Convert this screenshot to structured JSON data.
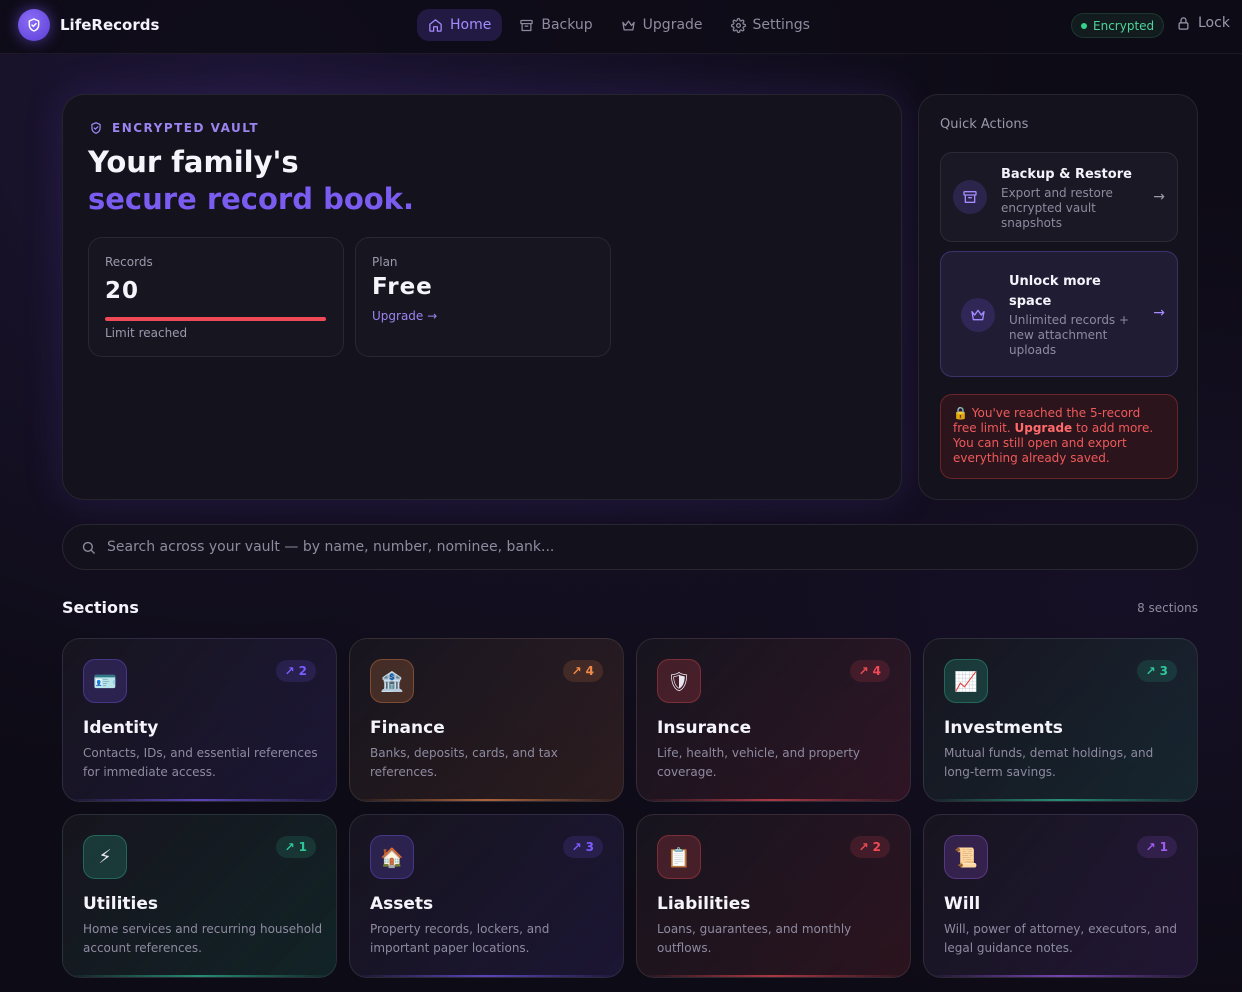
{
  "app": {
    "name": "LifeRecords"
  },
  "nav": [
    {
      "label": "Home",
      "icon": "home-icon",
      "active": true
    },
    {
      "label": "Backup",
      "icon": "archive-icon",
      "active": false
    },
    {
      "label": "Upgrade",
      "icon": "crown-icon",
      "active": false
    },
    {
      "label": "Settings",
      "icon": "gear-icon",
      "active": false
    }
  ],
  "status": {
    "encrypted_label": "Encrypted",
    "lock_label": "Lock"
  },
  "hero": {
    "eyebrow": "ENCRYPTED VAULT",
    "title_line1": "Your family's",
    "title_line2": "secure record book.",
    "records": {
      "label": "Records",
      "value": "20",
      "sub": "Limit reached",
      "usage_fraction": 1.0
    },
    "plan": {
      "label": "Plan",
      "value": "Free",
      "link": "Upgrade →"
    }
  },
  "quick_actions": {
    "title": "Quick Actions",
    "backup": {
      "name": "Backup & Restore",
      "desc": "Export and restore encrypted vault snapshots",
      "arrow": "→"
    },
    "upgrade": {
      "name": "Unlock more space",
      "desc": "Unlimited records + new attachment uploads",
      "arrow": "→"
    },
    "warning": {
      "prefix": "🔒 You've reached the 5-record free limit. ",
      "strong": "Upgrade",
      "suffix": " to add more. You can still open and export everything already saved."
    }
  },
  "search": {
    "placeholder": "Search across your vault — by name, number, nominee, bank..."
  },
  "sections_header": {
    "title": "Sections",
    "count": "8 sections"
  },
  "sections": [
    {
      "title": "Identity",
      "desc": "Contacts, IDs, and essential references for immediate access.",
      "count": "2",
      "icon": "id-card-icon",
      "emoji": "🪪",
      "accent": "#7c5cff"
    },
    {
      "title": "Finance",
      "desc": "Banks, deposits, cards, and tax references.",
      "count": "4",
      "icon": "bank-icon",
      "emoji": "🏦",
      "accent": "#f08a4b"
    },
    {
      "title": "Insurance",
      "desc": "Life, health, vehicle, and property coverage.",
      "count": "4",
      "icon": "shield-icon",
      "emoji": "🛡",
      "accent": "#ef4a55"
    },
    {
      "title": "Investments",
      "desc": "Mutual funds, demat holdings, and long-term savings.",
      "count": "3",
      "icon": "chart-icon",
      "emoji": "📈",
      "accent": "#2fc59a"
    },
    {
      "title": "Utilities",
      "desc": "Home services and recurring household account references.",
      "count": "1",
      "icon": "bolt-icon",
      "emoji": "⚡",
      "accent": "#2fc59a"
    },
    {
      "title": "Assets",
      "desc": "Property records, lockers, and important paper locations.",
      "count": "3",
      "icon": "house-icon",
      "emoji": "🏠",
      "accent": "#7c5cff"
    },
    {
      "title": "Liabilities",
      "desc": "Loans, guarantees, and monthly outflows.",
      "count": "2",
      "icon": "clipboard-icon",
      "emoji": "📋",
      "accent": "#ef4a55"
    },
    {
      "title": "Will",
      "desc": "Will, power of attorney, executors, and legal guidance notes.",
      "count": "1",
      "icon": "scroll-icon",
      "emoji": "📜",
      "accent": "#a05cf0"
    }
  ]
}
